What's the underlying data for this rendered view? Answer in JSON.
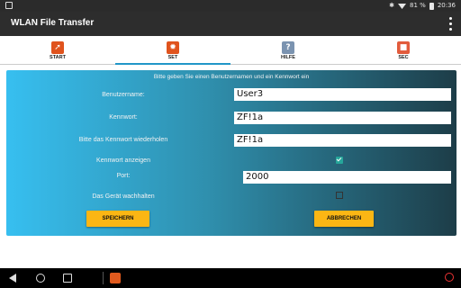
{
  "status_bar": {
    "battery": "81 %",
    "time": "20:36"
  },
  "app": {
    "title": "WLAN File Transfer"
  },
  "tabs": [
    {
      "label": "START",
      "icon": "rocket-icon",
      "color": "#e0531d"
    },
    {
      "label": "SET",
      "icon": "gear-icon",
      "color": "#e0531d"
    },
    {
      "label": "HILFE",
      "icon": "question-icon",
      "color": "#7b93b0"
    },
    {
      "label": "SEC",
      "icon": "lock-icon",
      "color": "#e25b3c"
    }
  ],
  "active_tab": "SET",
  "form": {
    "header": "Bitte geben Sie einen Benutzernamen und ein Kennwort ein",
    "username_label": "Benutzername:",
    "username_value": "User3",
    "password_label": "Kennwort:",
    "password_value": "ZF!1a",
    "password_repeat_label": "Bitte das Kennwort wiederholen",
    "password_repeat_value": "ZF!1a",
    "show_password_label": "Kennwort anzeigen",
    "show_password_checked": true,
    "port_label": "Port:",
    "port_value": "2000",
    "keep_awake_label": "Das Gerät wachhalten",
    "keep_awake_checked": false,
    "save_label": "SPEICHERN",
    "cancel_label": "ABBRECHEN"
  },
  "colors": {
    "accent": "#2196c8",
    "button": "#fbb614",
    "checkbox": "#26a69a"
  }
}
